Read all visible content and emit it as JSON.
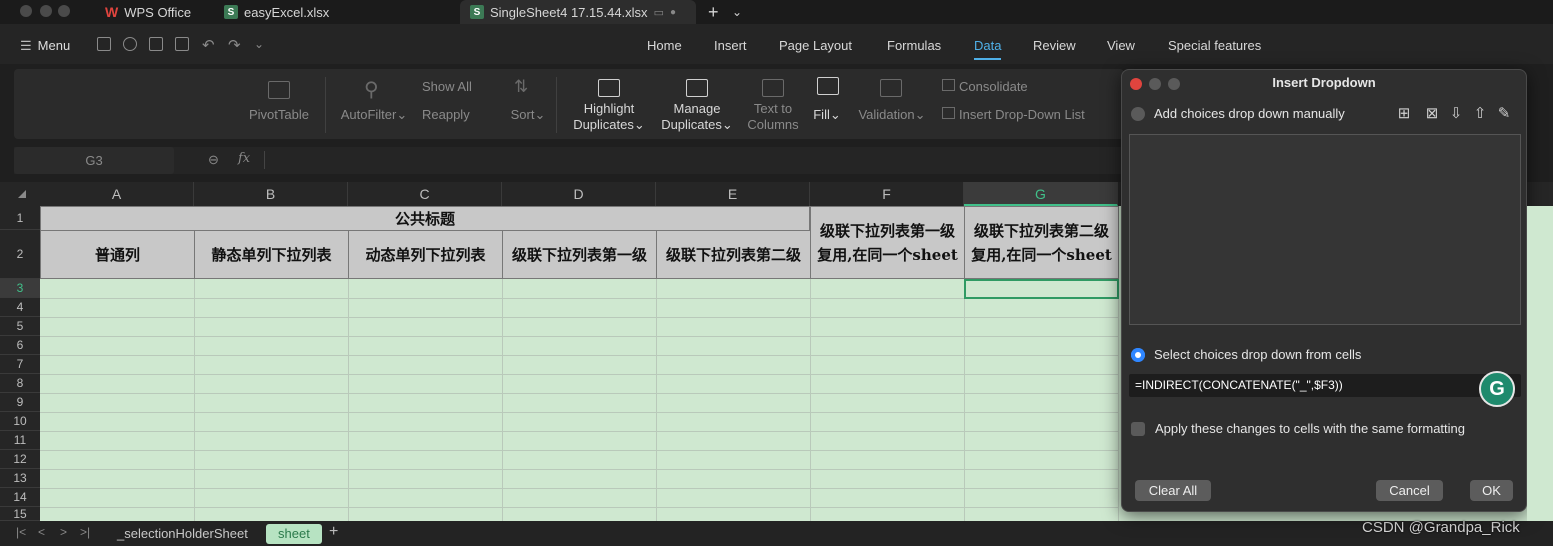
{
  "tabs": {
    "app": "WPS Office",
    "file1": "easyExcel.xlsx",
    "file2": "SingleSheet4 17.15.44.xlsx",
    "add": "+",
    "more": "⌄"
  },
  "menu": {
    "label": "Menu",
    "items": [
      "Home",
      "Insert",
      "Page Layout",
      "Formulas",
      "Data",
      "Review",
      "View",
      "Special features"
    ]
  },
  "ribbon": {
    "pivot": "PivotTable",
    "autofilter": "AutoFilter",
    "showall": "Show All",
    "reapply": "Reapply",
    "sort": "Sort",
    "highlight1": "Highlight",
    "highlight2": "Duplicates",
    "manage1": "Manage",
    "manage2": "Duplicates",
    "text1": "Text to",
    "text2": "Columns",
    "fill": "Fill",
    "validation": "Validation",
    "consolidate": "Consolidate",
    "dropdown": "Insert Drop-Down List",
    "caret": "⌄"
  },
  "formula": {
    "cell": "G3",
    "fx": "fx"
  },
  "columns": [
    "A",
    "B",
    "C",
    "D",
    "E",
    "F",
    "G"
  ],
  "rows": [
    "1",
    "2",
    "3",
    "4",
    "5",
    "6",
    "7",
    "8",
    "9",
    "10",
    "11",
    "12",
    "13",
    "14",
    "15"
  ],
  "sheet": {
    "title": "公共标题",
    "h_a": "普通列",
    "h_b": "静态单列下拉列表",
    "h_c": "动态单列下拉列表",
    "h_d": "级联下拉列表第一级",
    "h_e": "级联下拉列表第二级",
    "h_f": "级联下拉列表第一级复用,在同一个sheet",
    "h_g": "级联下拉列表第二级复用,在同一个sheet"
  },
  "sheettabs": {
    "t1": "_selectionHolderSheet",
    "t2": "sheet",
    "add": "+"
  },
  "dialog": {
    "title": "Insert Dropdown",
    "opt_manual": "Add choices drop down manually",
    "opt_cells": "Select choices drop down from cells",
    "formula": "=INDIRECT(CONCATENATE(\"_\",$F3))",
    "apply": "Apply these changes to cells with the same formatting",
    "clear": "Clear All",
    "cancel": "Cancel",
    "ok": "OK"
  },
  "watermark": "CSDN @Grandpa_Rick",
  "colors": {
    "accent": "#4fb0e8",
    "grid": "#cfe8d0",
    "selected_col": "#41c08a"
  }
}
